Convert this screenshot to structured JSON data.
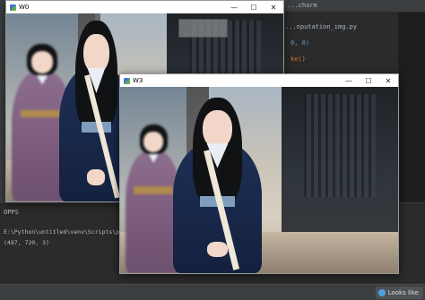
{
  "ide": {
    "editor_tab": "...charm",
    "code_file": "...nputation_img.py",
    "code_line_2": "0, 0)",
    "code_line_3": "ke()"
  },
  "terminal": {
    "tab_label": "OPPS",
    "command": "E:\\Python\\untitled\\venv\\Scripts\\python.exe",
    "output": "(487, 720, 3)"
  },
  "status_bar": {
    "toast_text": "Looks like"
  },
  "windows": [
    {
      "title": "W0",
      "controls": {
        "minimize": "—",
        "maximize": "☐",
        "close": "✕"
      }
    },
    {
      "title": "W3",
      "controls": {
        "minimize": "—",
        "maximize": "☐",
        "close": "✕"
      }
    }
  ],
  "colors": {
    "ide_bg": "#2b2b2b",
    "ide_panel": "#3c3f41",
    "robe_navy": "#1d2f55",
    "robe_lilac": "#8d6e8e"
  }
}
